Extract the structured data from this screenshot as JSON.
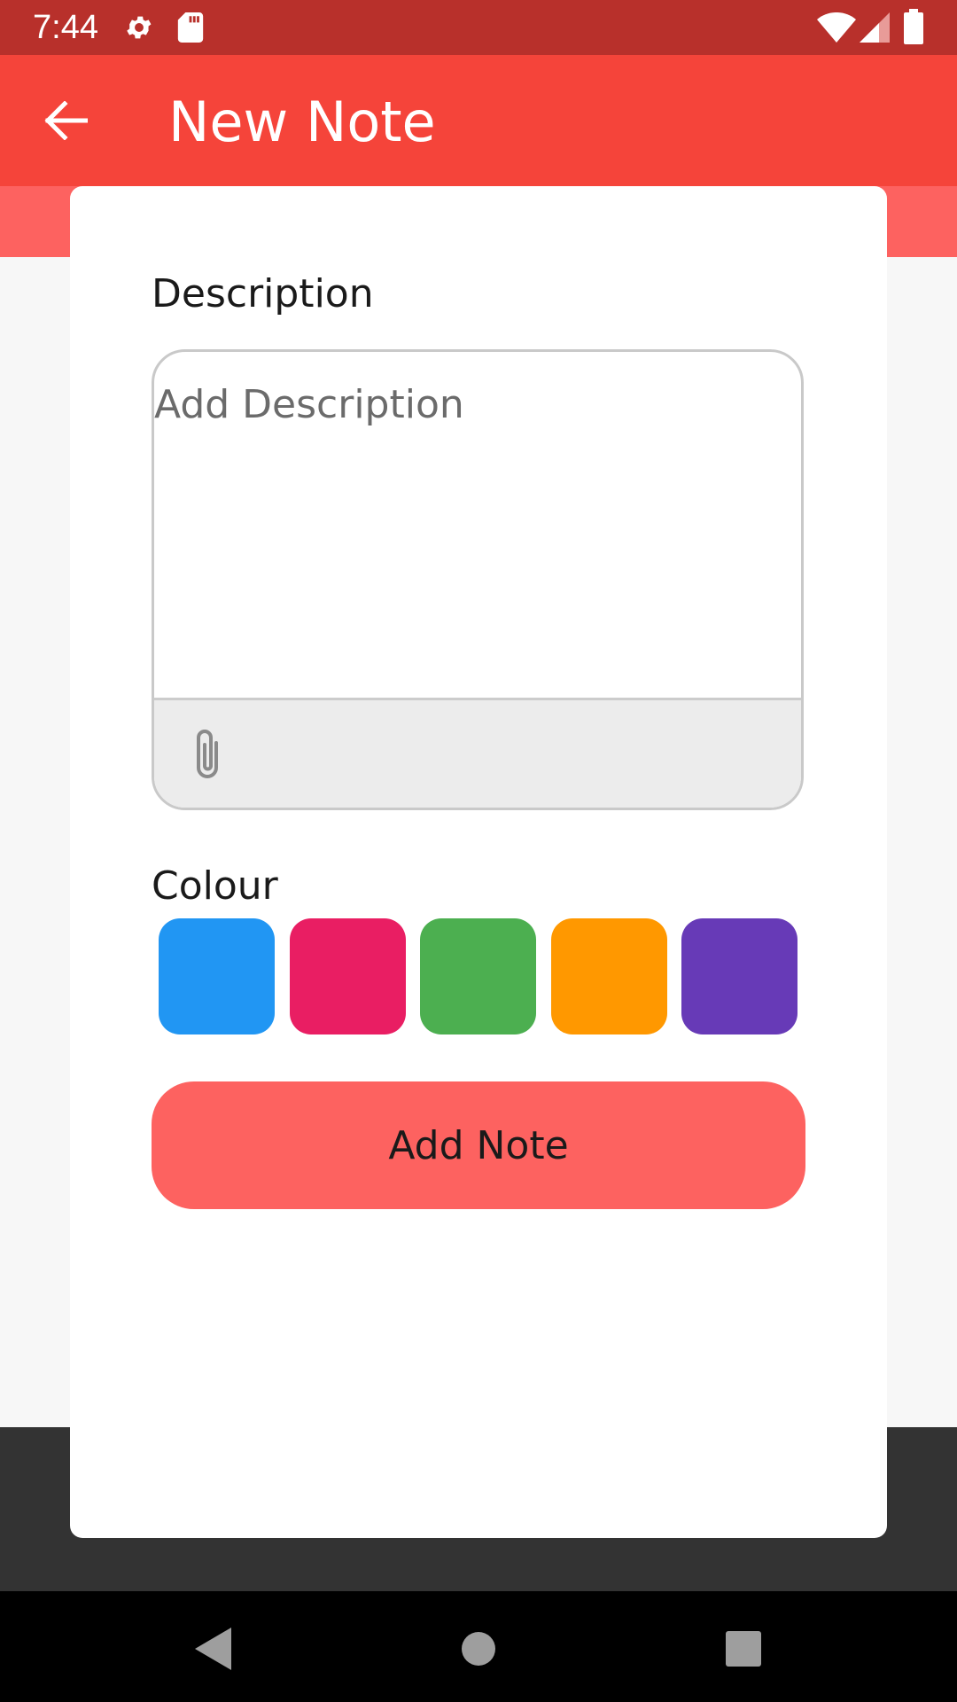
{
  "status_bar": {
    "time": "7:44",
    "icons": [
      "gear-icon",
      "sd-card-icon",
      "wifi-icon",
      "signal-icon",
      "battery-icon"
    ]
  },
  "app_bar": {
    "title": "New Note",
    "back_icon": "arrow-left-icon"
  },
  "form": {
    "description_label": "Description",
    "description_placeholder": "Add Description",
    "description_value": "",
    "attach_icon": "paperclip-icon",
    "colour_label": "Colour",
    "colours": [
      {
        "name": "blue",
        "hex": "#2196f3"
      },
      {
        "name": "pink",
        "hex": "#e91e63"
      },
      {
        "name": "green",
        "hex": "#4caf50"
      },
      {
        "name": "orange",
        "hex": "#ff9800"
      },
      {
        "name": "purple",
        "hex": "#673ab7"
      }
    ],
    "submit_label": "Add Note"
  },
  "theme": {
    "status_bar": "#b8302b",
    "app_bar": "#f5443a",
    "accent": "#fd6260"
  },
  "nav_bar": {
    "icons": [
      "back-triangle-icon",
      "home-circle-icon",
      "recents-square-icon"
    ]
  }
}
